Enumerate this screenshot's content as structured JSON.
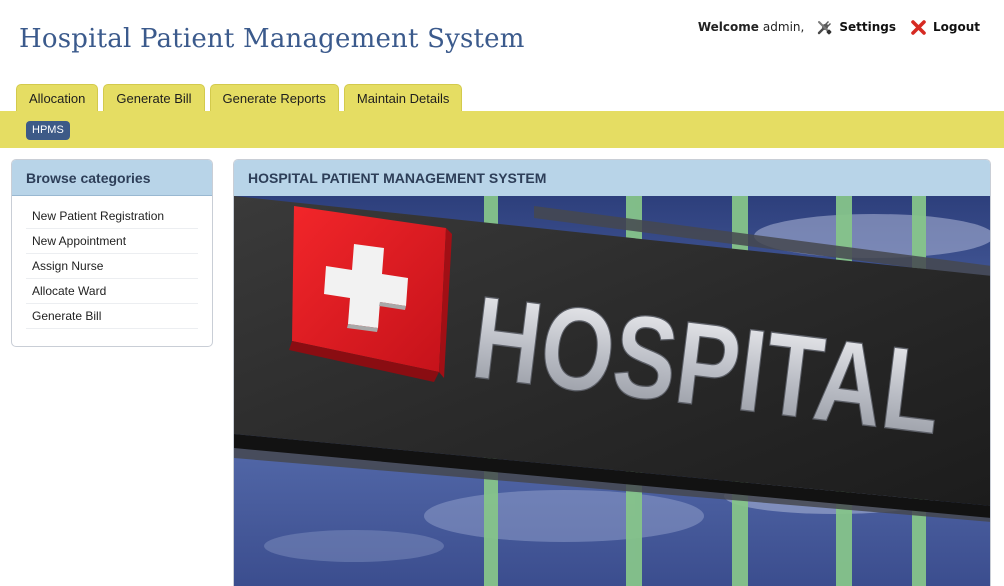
{
  "header": {
    "app_title": "Hospital Patient Management System",
    "welcome_label": "Welcome",
    "username": "admin,",
    "settings_label": "Settings",
    "logout_label": "Logout"
  },
  "tabs": [
    {
      "label": "Allocation"
    },
    {
      "label": "Generate Bill"
    },
    {
      "label": "Generate Reports"
    },
    {
      "label": "Maintain Details"
    }
  ],
  "subnav": {
    "chip_label": "HPMS"
  },
  "sidebar": {
    "title": "Browse categories",
    "items": [
      {
        "label": "New Patient Registration"
      },
      {
        "label": "New Appointment"
      },
      {
        "label": "Assign Nurse"
      },
      {
        "label": "Allocate Ward"
      },
      {
        "label": "Generate Bill"
      }
    ]
  },
  "main": {
    "title": "HOSPITAL PATIENT MANAGEMENT SYSTEM",
    "hero_sign_text": "HOSPITAL"
  },
  "colors": {
    "accent_yellow": "#e5dd63",
    "panel_header_blue": "#b8d4e8",
    "title_blue": "#3b5a8c",
    "chip_navy": "#3d5a87",
    "cross_red": "#e0191e"
  },
  "icons": {
    "settings": "tools-icon",
    "logout": "red-x-icon"
  }
}
